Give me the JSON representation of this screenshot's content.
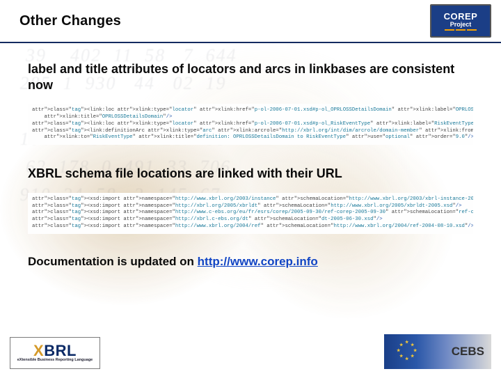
{
  "header": {
    "title": "Other Changes",
    "badge": {
      "line1": "COREP",
      "line2": "Project"
    }
  },
  "section1": {
    "heading": "label and title attributes of locators and arcs in linkbases are consistent now",
    "code": "<link:loc xlink:type=\"locator\" xlink:href=\"p-ol-2006-07-01.xsd#p-ol_OPRLOSSDetailsDomain\" xlink:label=\"OPRLOSSDetailsDomain\"\n    xlink:title=\"OPRLOSSDetailsDomain\"/>\n<link:loc xlink:type=\"locator\" xlink:href=\"p-ol-2006-07-01.xsd#p-ol_RiskEventType\" xlink:label=\"RiskEventType\" xlink:title=\"RiskEventType\"/>\n<link:definitionArc xlink:type=\"arc\" xlink:arcrole=\"http://xbrl.org/int/dim/arcrole/domain-member\" xlink:from=\"OPRLOSSDetailsDomain\"\n    xlink:to=\"RiskEventType\" xlink:title=\"definition: OPRLOSSDetailsDomain to RiskEventType\" use=\"optional\" order=\"9.0\"/>"
  },
  "section2": {
    "heading": "XBRL schema file locations are linked with their URL",
    "code": "<xsd:import namespace=\"http://www.xbrl.org/2003/instance\" schemaLocation=\"http://www.xbrl.org/2003/xbrl-instance-2003-12-31.xsd\"/>\n<xsd:import namespace=\"http://xbrl.org/2005/xbrldt\" schemaLocation=\"http://www.xbrl.org/2005/xbrldt-2005.xsd\"/>\n<xsd:import namespace=\"http://www.c-ebs.org/eu/fr/esrs/corep/2005-09-30/ref-corep-2005-09-30\" schemaLocation=\"ref-corep-2005-09-30.xsd\"/>\n<xsd:import namespace=\"http://xbrl.c-ebs.org/dt\" schemaLocation=\"dt-2005-06-30.xsd\"/>\n<xsd:import namespace=\"http://www.xbrl.org/2004/ref\" schemaLocation=\"http://www.xbrl.org/2004/ref-2004-08-10.xsd\"/>"
  },
  "docline": {
    "prefix": "Documentation is updated on ",
    "link_text": "http://www.corep.info",
    "link_href": "http://www.corep.info"
  },
  "footer": {
    "xbrl": {
      "text": "XBRL",
      "sub": "eXtensible Business Reporting Language"
    },
    "cebs": {
      "text": "CEBS"
    }
  },
  "bg_numbers": "  39    402  11  58   7  644\n 285  1  930   44   02  19\n   7  561   28  873  40  2\n 104   9  336   5  217  88\n  62  178  0  491  33  706\n 910  24  58   3  145  67\n   8  302  11  49  820  5"
}
